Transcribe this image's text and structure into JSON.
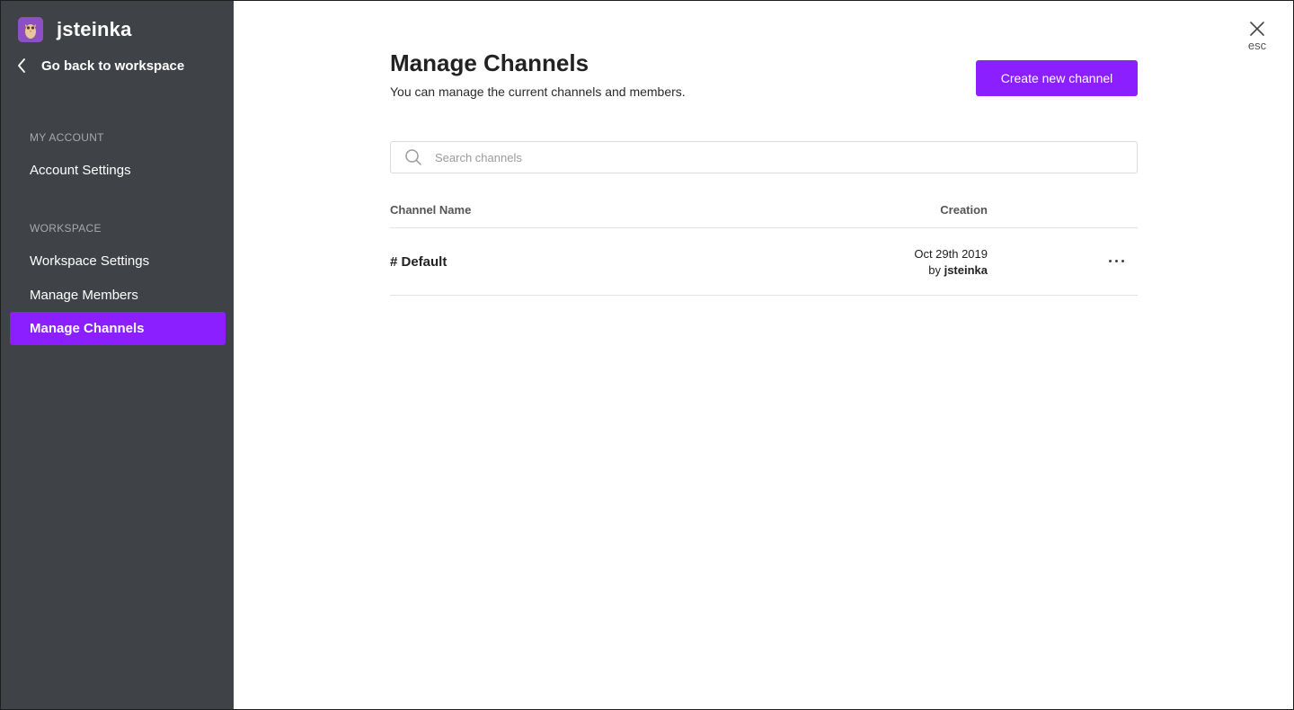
{
  "workspace": {
    "name": "jsteinka",
    "avatar_icon": "owl-avatar-icon",
    "back_label": "Go back to workspace"
  },
  "sidebar": {
    "sections": [
      {
        "title": "MY ACCOUNT",
        "items": [
          {
            "label": "Account Settings"
          }
        ]
      },
      {
        "title": "WORKSPACE",
        "items": [
          {
            "label": "Workspace Settings"
          },
          {
            "label": "Manage Members"
          },
          {
            "label": "Manage Channels",
            "active": true
          }
        ]
      }
    ]
  },
  "main": {
    "title": "Manage Channels",
    "subtitle": "You can manage the current channels and members.",
    "create_button": "Create new channel",
    "close_label": "esc",
    "search": {
      "placeholder": "Search channels",
      "value": ""
    },
    "table": {
      "columns": [
        "Channel Name",
        "Creation"
      ],
      "rows": [
        {
          "name": "# Default",
          "date": "Oct 29th 2019",
          "by_prefix": "by ",
          "by_user": "jsteinka"
        }
      ]
    }
  },
  "colors": {
    "sidebar_bg": "#3f4247",
    "accent": "#8c1fff",
    "avatar_bg": "#8d4fc4"
  }
}
